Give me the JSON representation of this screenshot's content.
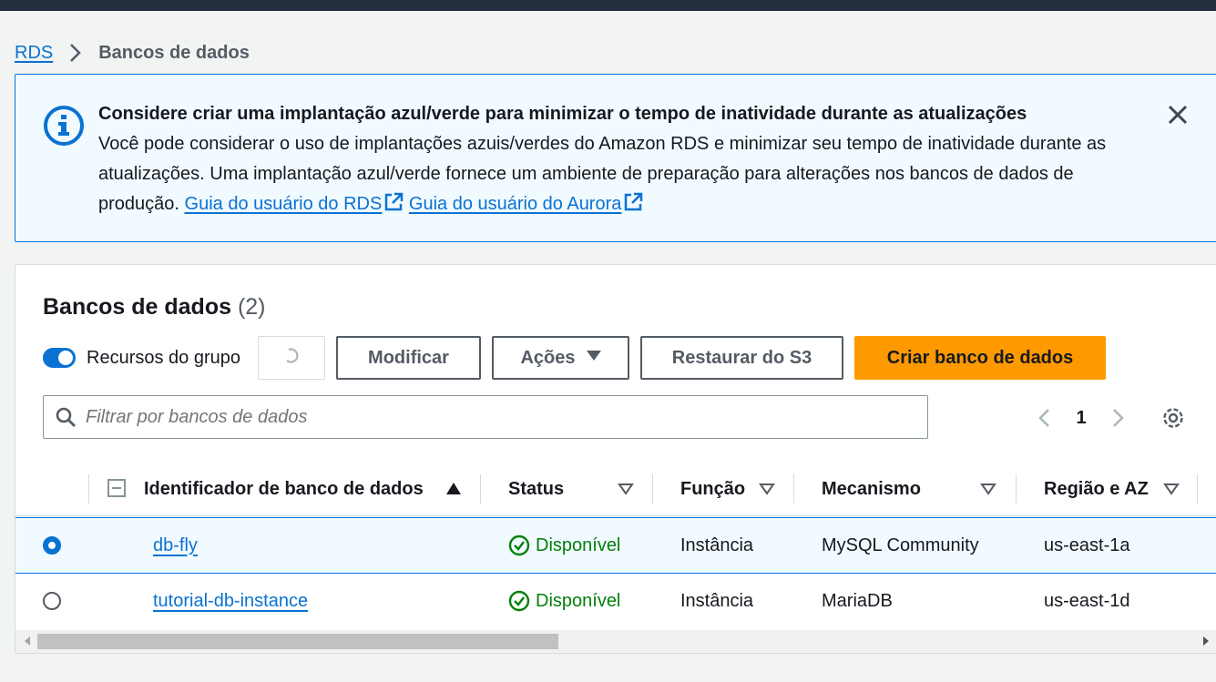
{
  "breadcrumb": {
    "root": "RDS",
    "current": "Bancos de dados"
  },
  "flash": {
    "title": "Considere criar uma implantação azul/verde para minimizar o tempo de inatividade durante as atualizações",
    "body": "Você pode considerar o uso de implantações azuis/verdes do Amazon RDS e minimizar seu tempo de inatividade durante as atualizações. Uma implantação azul/verde fornece um ambiente de preparação para alterações nos bancos de dados de produção.",
    "link_rds": "Guia do usuário do RDS",
    "link_aurora": "Guia do usuário do Aurora"
  },
  "panel": {
    "title": "Bancos de dados",
    "count": "(2)",
    "group_toggle_label": "Recursos do grupo",
    "group_toggle_on": true,
    "buttons": {
      "modify": "Modificar",
      "actions": "Ações",
      "restore": "Restaurar do S3",
      "create": "Criar banco de dados"
    },
    "search_placeholder": "Filtrar por bancos de dados",
    "page": "1"
  },
  "table": {
    "columns": {
      "identifier": "Identificador de banco de dados",
      "status": "Status",
      "role": "Função",
      "engine": "Mecanismo",
      "region": "Região e AZ"
    },
    "rows": [
      {
        "identifier": "db-fly",
        "status": "Disponível",
        "role": "Instância",
        "engine": "MySQL Community",
        "region": "us-east-1a",
        "selected": true
      },
      {
        "identifier": "tutorial-db-instance",
        "status": "Disponível",
        "role": "Instância",
        "engine": "MariaDB",
        "region": "us-east-1d",
        "selected": false
      }
    ]
  },
  "colors": {
    "accent": "#0972d3",
    "primary_button": "#ff9900",
    "success": "#037f0c",
    "topbar": "#232f3e"
  },
  "icons": [
    "info-icon",
    "close-icon",
    "external-link-icon",
    "refresh-icon",
    "caret-down-icon",
    "search-icon",
    "chevron-left-icon",
    "chevron-right-icon",
    "gear-icon",
    "sort-asc-icon",
    "sort-desc-icon",
    "collapse-icon",
    "status-check-icon"
  ]
}
